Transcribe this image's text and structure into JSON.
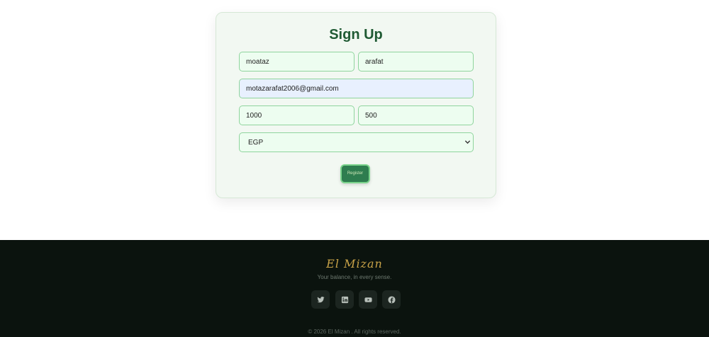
{
  "signup": {
    "title": "Sign Up",
    "first_name": "moataz",
    "last_name": "arafat",
    "email": "motazarafat2006@gmail.com",
    "amount_1": "1000",
    "amount_2": "500",
    "currency": "EGP",
    "register_label": "Register"
  },
  "footer": {
    "brand": "El Mizan",
    "tagline": "Your balance, in every sense.",
    "socials": [
      "twitter-icon",
      "linkedin-icon",
      "youtube-icon",
      "facebook-icon"
    ],
    "copyright": "© 2026 El Mizan . All rights reserved."
  },
  "colors": {
    "primary_green": "#2e7d4f",
    "title_green": "#1f5a33",
    "footer_bg": "#0b130e",
    "brand_gold": "#c9a348",
    "input_bg": "#edfdf0",
    "input_border": "#8fd49d"
  }
}
